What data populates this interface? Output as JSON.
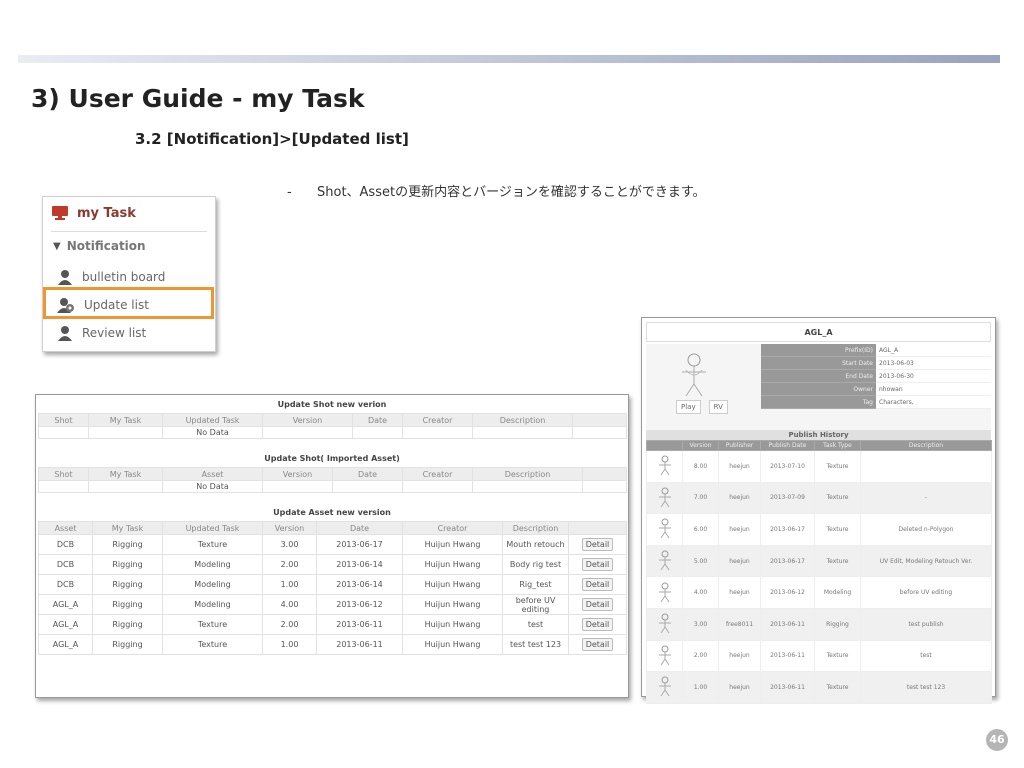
{
  "slide": {
    "title": "3) User Guide - my Task",
    "subtitle": "3.2 [Notification]>[Updated list]",
    "bullet": "Shot、Assetの更新内容とバージョンを確認することができます。",
    "page_number": "46"
  },
  "menu": {
    "header": "my Task",
    "section": "Notification",
    "items": [
      "bulletin board",
      "Update list",
      "Review list"
    ]
  },
  "tables": {
    "shot_update": {
      "title": "Update Shot new verion",
      "headers": [
        "Shot",
        "My Task",
        "Updated Task",
        "Version",
        "Date",
        "Creator",
        "Description",
        ""
      ],
      "empty": "No Data"
    },
    "shot_imported": {
      "title": "Update Shot( Imported Asset)",
      "headers": [
        "Shot",
        "My Task",
        "Asset",
        "Version",
        "Date",
        "Creator",
        "Description",
        ""
      ],
      "empty": "No Data"
    },
    "asset_update": {
      "title": "Update Asset new version",
      "headers": [
        "Asset",
        "My Task",
        "Updated Task",
        "Version",
        "Date",
        "Creator",
        "Description",
        ""
      ],
      "detail_label": "Detail",
      "rows": [
        [
          "DCB",
          "Rigging",
          "Texture",
          "3.00",
          "2013-06-17",
          "Huijun Hwang",
          "Mouth retouch"
        ],
        [
          "DCB",
          "Rigging",
          "Modeling",
          "2.00",
          "2013-06-14",
          "Huijun Hwang",
          "Body rig test"
        ],
        [
          "DCB",
          "Rigging",
          "Modeling",
          "1.00",
          "2013-06-14",
          "Huijun Hwang",
          "Rig_test"
        ],
        [
          "AGL_A",
          "Rigging",
          "Modeling",
          "4.00",
          "2013-06-12",
          "Huijun Hwang",
          "before UV editing"
        ],
        [
          "AGL_A",
          "Rigging",
          "Texture",
          "2.00",
          "2013-06-11",
          "Huijun Hwang",
          "test"
        ],
        [
          "AGL_A",
          "Rigging",
          "Texture",
          "1.00",
          "2013-06-11",
          "Huijun Hwang",
          "test test 123"
        ]
      ]
    }
  },
  "asset_panel": {
    "title": "AGL_A",
    "buttons": [
      "Play",
      "RV"
    ],
    "info": [
      {
        "label": "Prefix(ID)",
        "value": "AGL_A"
      },
      {
        "label": "Start Date",
        "value": "2013-06-03"
      },
      {
        "label": "End Date",
        "value": "2013-06-30"
      },
      {
        "label": "Owner",
        "value": "nhowan"
      },
      {
        "label": "Tag",
        "value": "Characters,"
      }
    ],
    "history_title": "Publish History",
    "history_headers": [
      "",
      "Version",
      "Publisher",
      "Publish Date",
      "Task Type",
      "Description"
    ],
    "history": [
      [
        "8.00",
        "heejun",
        "2013-07-10",
        "Texture",
        ""
      ],
      [
        "7.00",
        "heejun",
        "2013-07-09",
        "Texture",
        "-"
      ],
      [
        "6.00",
        "heejun",
        "2013-06-17",
        "Texture",
        "Deleted n-Polygon"
      ],
      [
        "5.00",
        "heejun",
        "2013-06-17",
        "Texture",
        "UV Edit, Modeling Retouch Ver."
      ],
      [
        "4.00",
        "heejun",
        "2013-06-12",
        "Modeling",
        "before UV editing"
      ],
      [
        "3.00",
        "free8011",
        "2013-06-11",
        "Rigging",
        "test publish"
      ],
      [
        "2.00",
        "heejun",
        "2013-06-11",
        "Texture",
        "test"
      ],
      [
        "1.00",
        "heejun",
        "2013-06-11",
        "Texture",
        "test test 123"
      ]
    ]
  },
  "colors": {
    "accent_bar": "#9aa3bf",
    "highlight": "#f0962f",
    "menu_header": "#8a3a2e"
  }
}
